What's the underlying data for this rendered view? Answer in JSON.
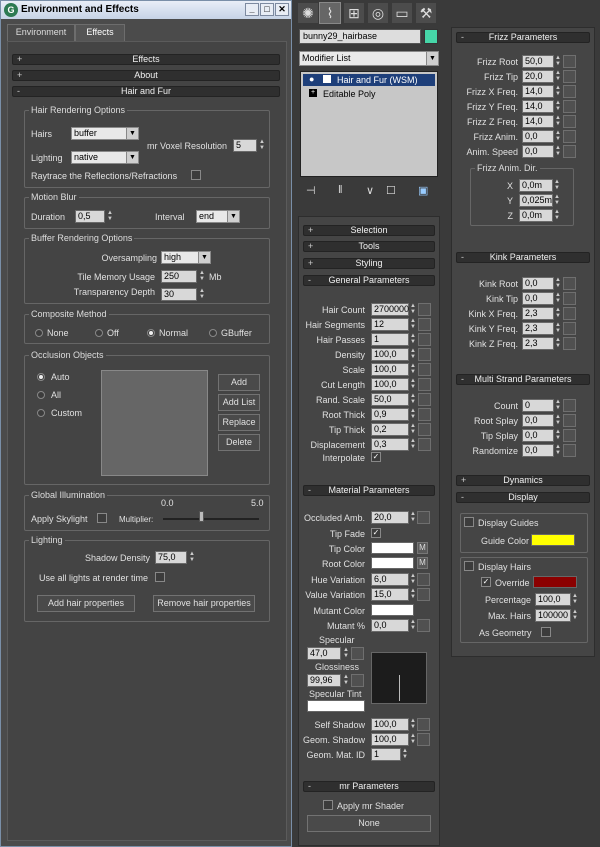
{
  "window": {
    "title": "Environment and Effects",
    "min": "_",
    "restore": "□",
    "close": "✕"
  },
  "tabs": [
    "Environment",
    "Effects"
  ],
  "rollouts": {
    "effects": "Effects",
    "about": "About",
    "hair_and_fur": "Hair and Fur"
  },
  "hair_rendering": {
    "title": "Hair Rendering Options",
    "hairs_label": "Hairs",
    "hairs_value": "buffer",
    "voxel_label": "mr Voxel Resolution",
    "voxel_value": "5",
    "lighting_label": "Lighting",
    "lighting_value": "native",
    "raytrace_label": "Raytrace the Reflections/Refractions"
  },
  "motion_blur": {
    "title": "Motion Blur",
    "duration_label": "Duration",
    "duration_value": "0,5",
    "interval_label": "Interval",
    "interval_value": "end"
  },
  "buffer_options": {
    "title": "Buffer Rendering Options",
    "oversampling_label": "Oversampling",
    "oversampling_value": "high",
    "tile_label": "Tile Memory Usage",
    "tile_value": "250",
    "tile_unit": "Mb",
    "transp_label": "Transparency Depth",
    "transp_value": "30"
  },
  "composite": {
    "title": "Composite Method",
    "options": [
      "None",
      "Off",
      "Normal",
      "GBuffer"
    ],
    "selected": "Normal"
  },
  "occlusion": {
    "title": "Occlusion Objects",
    "options": [
      "Auto",
      "All",
      "Custom"
    ],
    "selected": "Auto",
    "buttons": [
      "Add",
      "Add List",
      "Replace",
      "Delete"
    ]
  },
  "global_illum": {
    "title": "Global Illumination",
    "tick_min": "0.0",
    "tick_max": "5.0",
    "apply_label": "Apply Skylight",
    "multiplier_label": "Multiplier:",
    "multiplier_value": 0.4
  },
  "lighting": {
    "title": "Lighting",
    "shadow_label": "Shadow Density",
    "shadow_value": "75,0",
    "use_all_label": "Use all lights at render time",
    "add_btn": "Add hair properties",
    "remove_btn": "Remove hair properties"
  },
  "toolbar_icons": [
    "sun-gear-icon",
    "curve-icon",
    "hierarchy-icon",
    "motion-icon",
    "display-icon",
    "hammer-icon"
  ],
  "modifier": {
    "object_name": "bunny29_hairbase",
    "object_color": "#46d6a8",
    "list_label": "Modifier List",
    "stack": [
      "Hair and Fur (WSM)",
      "Editable Poly"
    ]
  },
  "stack_tools": [
    "pin-icon",
    "show-end-icon",
    "make-unique-icon",
    "remove-modifier-icon",
    "configure-icon"
  ],
  "mid_rollouts": {
    "selection": "Selection",
    "tools": "Tools",
    "styling": "Styling",
    "general": "General Parameters",
    "material": "Material Parameters",
    "mr": "mr Parameters"
  },
  "general": [
    {
      "label": "Hair Count",
      "value": "2700000"
    },
    {
      "label": "Hair Segments",
      "value": "12"
    },
    {
      "label": "Hair Passes",
      "value": "1"
    },
    {
      "label": "Density",
      "value": "100,0"
    },
    {
      "label": "Scale",
      "value": "100,0"
    },
    {
      "label": "Cut Length",
      "value": "100,0"
    },
    {
      "label": "Rand. Scale",
      "value": "50,0"
    },
    {
      "label": "Root Thick",
      "value": "0,9"
    },
    {
      "label": "Tip Thick",
      "value": "0,2"
    },
    {
      "label": "Displacement",
      "value": "0,3"
    }
  ],
  "interpolate_label": "Interpolate",
  "material": {
    "occluded_label": "Occluded Amb.",
    "occluded_value": "20,0",
    "tip_fade_label": "Tip Fade",
    "tip_color_label": "Tip Color",
    "root_color_label": "Root Color",
    "m": "M",
    "hue_label": "Hue Variation",
    "hue_value": "6,0",
    "value_var_label": "Value Variation",
    "value_var_value": "15,0",
    "mutant_color_label": "Mutant Color",
    "mutant_pct_label": "Mutant %",
    "mutant_pct_value": "0,0",
    "specular_label": "Specular",
    "specular_value": "47,0",
    "gloss_label": "Glossiness",
    "gloss_value": "99,96",
    "tint_label": "Specular Tint",
    "self_shadow_label": "Self Shadow",
    "self_shadow_value": "100,0",
    "geom_shadow_label": "Geom. Shadow",
    "geom_shadow_value": "100,0",
    "geom_mat_label": "Geom. Mat. ID",
    "geom_mat_value": "1"
  },
  "mr": {
    "apply_label": "Apply mr Shader",
    "shader_btn": "None"
  },
  "frizz": {
    "title": "Frizz Parameters",
    "rows": [
      {
        "label": "Frizz Root",
        "value": "50,0"
      },
      {
        "label": "Frizz Tip",
        "value": "20,0"
      },
      {
        "label": "Frizz X Freq.",
        "value": "14,0"
      },
      {
        "label": "Frizz Y Freq.",
        "value": "14,0"
      },
      {
        "label": "Frizz Z Freq.",
        "value": "14,0"
      },
      {
        "label": "Frizz Anim.",
        "value": "0,0"
      },
      {
        "label": "Anim. Speed",
        "value": "0,0"
      }
    ],
    "dir_title": "Frizz Anim. Dir.",
    "dir": [
      {
        "label": "X",
        "value": "0,0m"
      },
      {
        "label": "Y",
        "value": "0,025m"
      },
      {
        "label": "Z",
        "value": "0,0m"
      }
    ]
  },
  "kink": {
    "title": "Kink Parameters",
    "rows": [
      {
        "label": "Kink Root",
        "value": "0,0"
      },
      {
        "label": "Kink Tip",
        "value": "0,0"
      },
      {
        "label": "Kink X Freq.",
        "value": "2,3"
      },
      {
        "label": "Kink Y Freq.",
        "value": "2,3"
      },
      {
        "label": "Kink Z Freq.",
        "value": "2,3"
      }
    ]
  },
  "multi": {
    "title": "Multi Strand Parameters",
    "rows": [
      {
        "label": "Count",
        "value": "0"
      },
      {
        "label": "Root Splay",
        "value": "0,0"
      },
      {
        "label": "Tip Splay",
        "value": "0,0"
      },
      {
        "label": "Randomize",
        "value": "0,0"
      }
    ]
  },
  "dynamics": "Dynamics",
  "display": {
    "title": "Display",
    "guides_label": "Display Guides",
    "guide_color_label": "Guide Color",
    "guide_color": "#ffff00",
    "hairs_label": "Display Hairs",
    "override_label": "Override",
    "override_color": "#8b0000",
    "percentage_label": "Percentage",
    "percentage_value": "100,0",
    "max_hairs_label": "Max. Hairs",
    "max_hairs_value": "100000",
    "geometry_label": "As Geometry"
  },
  "colors": {
    "tip": "#ffffff",
    "root": "#ffffff",
    "mutant": "#ffffff",
    "tint": "#ffffff"
  }
}
